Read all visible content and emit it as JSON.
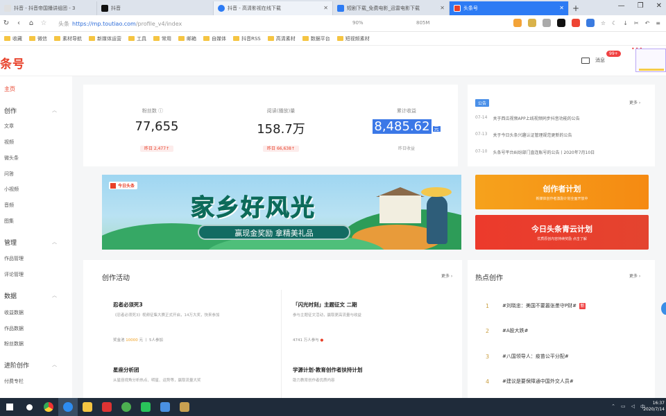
{
  "browser": {
    "tabs": [
      {
        "label": "抖音 - 抖音帝国播讲组团 - 3",
        "favicon_color": "#e0e0e0"
      },
      {
        "label": "抖音",
        "favicon_color": "#111111"
      },
      {
        "label": "抖音 - 高清影视在线下载",
        "favicon_color": "#2d7bf4"
      },
      {
        "label": "短剧下载_免费电影_迅雷电影下载",
        "favicon_color": "#2d7bf4"
      },
      {
        "label": "头条号",
        "favicon_color": "#e8412a"
      }
    ],
    "address": {
      "site_label": "头条",
      "host": "https://mp.toutiao.com",
      "path": "/profile_v4/index"
    },
    "zoom": "90%",
    "download_label": "805M",
    "bookmarks": [
      "收藏",
      "微信",
      "素材导航",
      "新媒体运营",
      "工具",
      "常用",
      "邮箱",
      "自媒体",
      "抖音RSS",
      "高清素材",
      "数据平台",
      "短视频素材"
    ]
  },
  "header": {
    "logo": "条号",
    "message_label": "消息",
    "message_badge": "99+",
    "dots": "•••"
  },
  "sidebar": {
    "home": "主页",
    "groups": [
      {
        "title": "创作",
        "items": [
          "文章",
          "视频",
          "微头条",
          "问答",
          "小视频",
          "音频",
          "图集"
        ]
      },
      {
        "title": "管理",
        "items": [
          "作品管理",
          "评论管理"
        ]
      },
      {
        "title": "数据",
        "items": [
          "收益数据",
          "作品数据",
          "粉丝数据"
        ]
      },
      {
        "title": "进阶创作",
        "items": [
          "付费专栏"
        ]
      }
    ]
  },
  "stats": [
    {
      "label": "粉丝数 ⓘ",
      "value": "77,655",
      "sub": "昨日 2,477↑",
      "unit": ""
    },
    {
      "label": "阅读(播放)量",
      "value": "158.7万",
      "sub": "昨日 66,638↑",
      "unit": ""
    },
    {
      "label": "累计收益",
      "value": "8,485.62",
      "sub": "昨日收益",
      "unit": "元"
    }
  ],
  "announcements": {
    "tag": "公告",
    "more": "更多 ›",
    "items": [
      {
        "date": "07-14",
        "text": "关于西瓜视频APP上线视频同步抖音功能的公告"
      },
      {
        "date": "07-13",
        "text": "关于今日头条兴趣认证管理规范更新的公告"
      },
      {
        "date": "07-10",
        "text": "头条号平台纠纷部门直连账号的公告丨2020年7月10日"
      }
    ]
  },
  "banner": {
    "brand": "今日头条",
    "title": "家乡好风光",
    "pill": "赢现金奖励 拿精美礼品"
  },
  "promos": [
    {
      "title": "创作者计划",
      "sub": "新媒体创作者激励计划全面开放中"
    },
    {
      "title": "今日头条青云计划",
      "sub": "优质原创内容持续奖励 点击了解"
    }
  ],
  "activities": {
    "title": "创作活动",
    "more": "更多 ›",
    "items": [
      {
        "title": "忍者必须死3",
        "desc": "《忍者必须死3》视频征集大赛正式开启，14万大奖，快来参加",
        "meta_prefix": "奖金池",
        "meta_value": "10000",
        "meta_suffix": "元 丨 5人参加"
      },
      {
        "title": "「闪光时刻」主题征文 二期",
        "desc": "参与主题征文活动，赢取更高流量与收益",
        "meta_prefix": "4741 万人参与",
        "meta_value": "●",
        "meta_suffix": ""
      },
      {
        "title": "星座分析团",
        "desc": "从星座视角分析热点、明星、运势等，赢取流量大奖",
        "meta_prefix": "",
        "meta_value": "",
        "meta_suffix": ""
      },
      {
        "title": "学源计划·教育创作者扶持计划",
        "desc": "助力教育创作者优质内容",
        "meta_prefix": "",
        "meta_value": "",
        "meta_suffix": ""
      }
    ]
  },
  "hot": {
    "title": "热点创作",
    "more": "更多 ›",
    "items": [
      {
        "rank": "1",
        "text": "#刘晓忠：美国不要嚣张墨守P财#",
        "tag": "新"
      },
      {
        "rank": "2",
        "text": "#A股大跌#",
        "tag": ""
      },
      {
        "rank": "3",
        "text": "#八国领导人：疫苗公平分配#",
        "tag": ""
      },
      {
        "rank": "4",
        "text": "#建议是要保障通中国外交人员#",
        "tag": ""
      }
    ]
  },
  "taskbar": {
    "time": "16:37",
    "date": "2020/7/14",
    "tray_text": "中"
  }
}
